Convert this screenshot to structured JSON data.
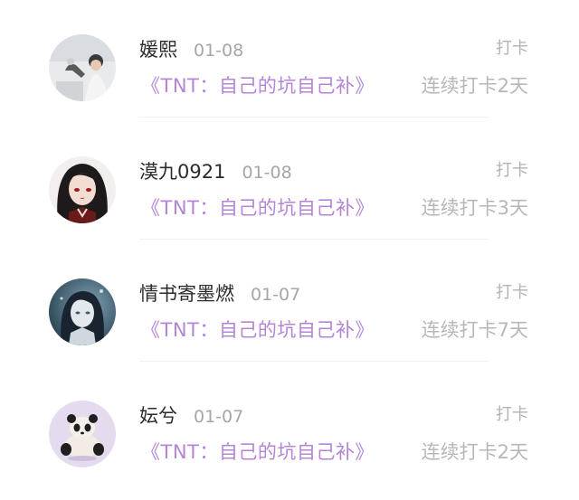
{
  "entries": [
    {
      "name": "媛熙",
      "date": "01-08",
      "action": "打卡",
      "topic": "《TNT：自己的坑自己补》",
      "streak": "连续打卡2天",
      "avatar_icon": "person-photo-avatar"
    },
    {
      "name": "漠九0921",
      "date": "01-08",
      "action": "打卡",
      "topic": "《TNT：自己的坑自己补》",
      "streak": "连续打卡3天",
      "avatar_icon": "anime-character-avatar"
    },
    {
      "name": "情书寄墨燃",
      "date": "01-07",
      "action": "打卡",
      "topic": "《TNT：自己的坑自己补》",
      "streak": "连续打卡7天",
      "avatar_icon": "illustrated-character-avatar"
    },
    {
      "name": "妘兮",
      "date": "01-07",
      "action": "打卡",
      "topic": "《TNT：自己的坑自己补》",
      "streak": "连续打卡2天",
      "avatar_icon": "panda-avatar"
    }
  ],
  "colors": {
    "topic": "#b485d6",
    "name": "#2b2b2b",
    "muted": "#b3b3b3"
  }
}
